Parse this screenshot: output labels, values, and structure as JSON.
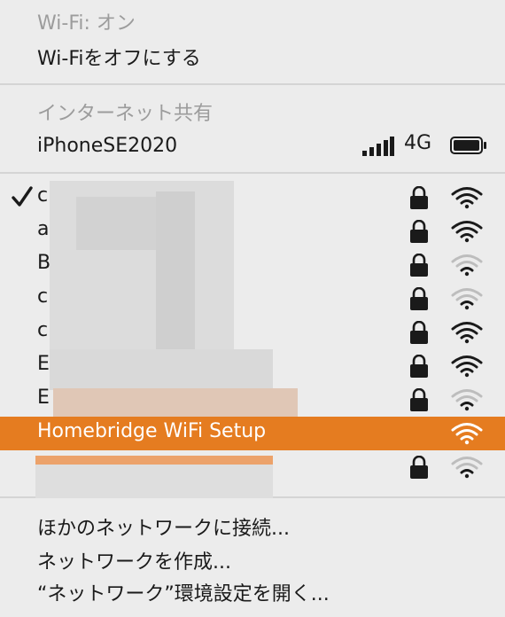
{
  "wifi_section": {
    "status_label": "Wi-Fi: オン",
    "toggle_label": "Wi-Fiをオフにする"
  },
  "hotspot_section": {
    "header": "インターネット共有",
    "device_name": "iPhoneSE2020",
    "network_type": "4G"
  },
  "networks": [
    {
      "ssid_visible": "c",
      "selected": true,
      "locked": true,
      "signal": 3
    },
    {
      "ssid_visible": "a",
      "selected": false,
      "locked": true,
      "signal": 3
    },
    {
      "ssid_visible": "B",
      "selected": false,
      "locked": true,
      "signal": 1
    },
    {
      "ssid_visible": "c",
      "selected": false,
      "locked": true,
      "signal": 1
    },
    {
      "ssid_visible": "c",
      "selected": false,
      "locked": true,
      "signal": 3
    },
    {
      "ssid_visible": "E",
      "selected": false,
      "locked": true,
      "signal": 3
    },
    {
      "ssid_visible": "E",
      "selected": false,
      "locked": true,
      "signal": 1
    },
    {
      "ssid_visible": "Homebridge WiFi Setup",
      "selected": false,
      "locked": false,
      "signal": 3,
      "highlighted": true
    },
    {
      "ssid_visible": "",
      "selected": false,
      "locked": true,
      "signal": 1
    }
  ],
  "actions": {
    "join_other": "ほかのネットワークに接続...",
    "create_network": "ネットワークを作成...",
    "open_prefs": "“ネットワーク”環境設定を開く..."
  },
  "colors": {
    "menu_bg": "#ececec",
    "highlight": "#e57c20",
    "text": "#1a1a1a",
    "disabled_text": "#9c9c9c"
  }
}
